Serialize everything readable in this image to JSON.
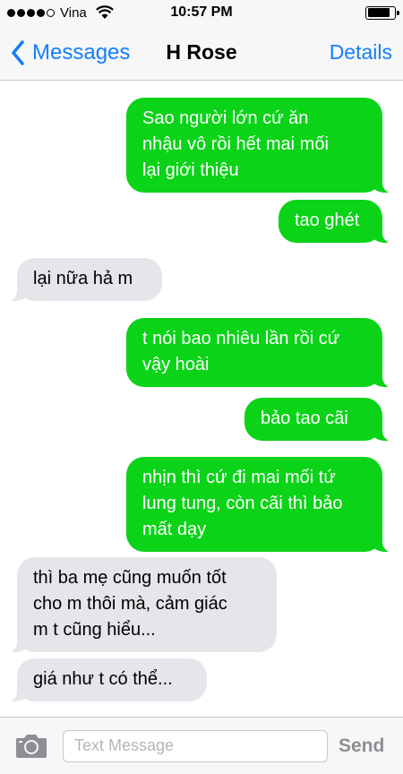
{
  "status_bar": {
    "carrier": "Vina",
    "time": "10:57 PM",
    "signal_bars_filled": 4,
    "signal_bars_total": 5,
    "battery_level": 0.85
  },
  "nav": {
    "back_label": "Messages",
    "title": "H Rose",
    "details_label": "Details"
  },
  "messages": [
    {
      "side": "sent",
      "text": "Sao người lớn cứ ăn\nnhậu vô rồi hết mai mối\nlại giới thiệu"
    },
    {
      "side": "sent",
      "text": "tao ghét"
    },
    {
      "side": "received",
      "text": "lại nữa hả m"
    },
    {
      "side": "sent",
      "text": "t nói bao nhiêu lần rồi cứ\nvậy hoài"
    },
    {
      "side": "sent",
      "text": "bảo tao cãi"
    },
    {
      "side": "sent",
      "text": "nhịn thì cứ đi mai mối tứ\nlung tung, còn cãi thì bảo\nmất dạy"
    },
    {
      "side": "received",
      "text": "thì ba mẹ cũng muốn tốt\ncho m thôi mà, cảm giác\nm t cũng hiểu..."
    },
    {
      "side": "received",
      "text": "giá như t có thể..."
    }
  ],
  "input": {
    "placeholder": "Text Message",
    "send_label": "Send"
  },
  "colors": {
    "sent_bubble": "#0bd318",
    "received_bubble": "#e5e5ea",
    "accent": "#147efb"
  }
}
